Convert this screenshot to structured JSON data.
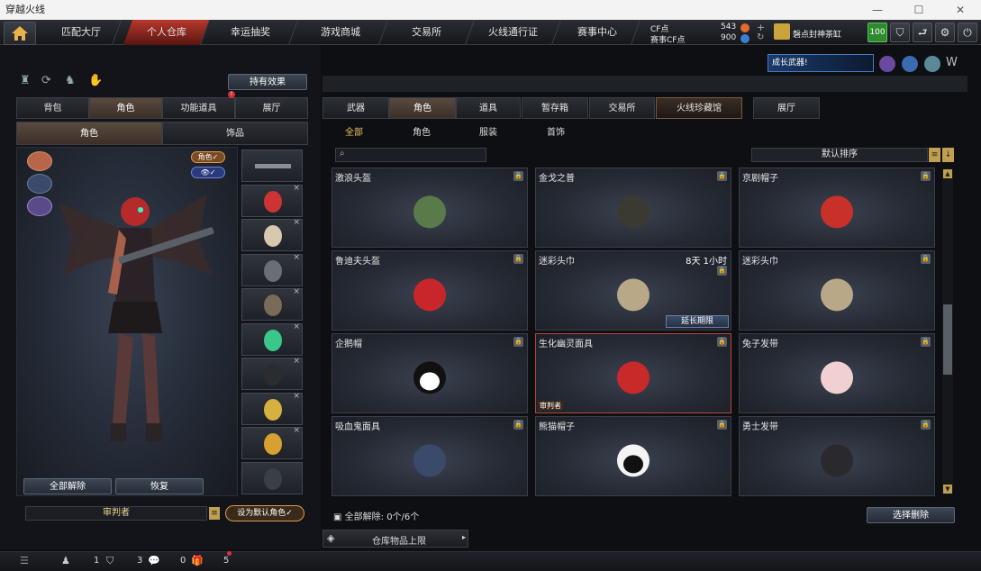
{
  "window": {
    "title": "穿越火线"
  },
  "nav": {
    "tabs": [
      "匹配大厅",
      "个人仓库",
      "幸运抽奖",
      "游戏商城",
      "交易所",
      "火线通行证",
      "赛事中心"
    ],
    "active_index": 1,
    "cf_label": "CF点",
    "cf_value": "543",
    "match_cf_label": "赛事CF点",
    "match_cf_value": "900",
    "username": "磐点封神茶缸",
    "level_badge": "100"
  },
  "left": {
    "effects_button": "持有效果",
    "tabs": [
      "背包",
      "角色",
      "功能道具",
      "展厅"
    ],
    "active_tab": 1,
    "subtabs": [
      "角色",
      "饰品"
    ],
    "role_badge": "角色✓",
    "unequip_all": "全部解除",
    "restore": "恢复",
    "character_name": "审判者",
    "set_default": "设为默认角色✓"
  },
  "right": {
    "tabs": [
      "武器",
      "角色",
      "道具",
      "暂存箱",
      "交易所",
      "火线珍藏馆",
      "展厅"
    ],
    "active_tab": 1,
    "subtabs": [
      "全部",
      "角色",
      "服装",
      "首饰"
    ],
    "sort_label": "默认排序",
    "search_placeholder": "",
    "items": [
      {
        "name": "激浪头盔",
        "icon": "green-helmet-icon"
      },
      {
        "name": "金戈之普",
        "icon": "officer-cap-icon"
      },
      {
        "name": "京剧帽子",
        "icon": "opera-hat-icon"
      },
      {
        "name": "鲁迪夫头盔",
        "icon": "reindeer-helmet-icon"
      },
      {
        "name": "迷彩头巾",
        "icon": "camo-helmet-icon",
        "timer": "8天 1小时",
        "action": "延长期限"
      },
      {
        "name": "迷彩头巾",
        "icon": "camo-helmet-icon"
      },
      {
        "name": "企鹅帽",
        "icon": "penguin-hat-icon"
      },
      {
        "name": "生化幽灵面具",
        "icon": "red-skull-mask-icon",
        "tag": "审判者",
        "selected": true
      },
      {
        "name": "兔子发带",
        "icon": "bunny-ears-icon"
      },
      {
        "name": "吸血鬼面具",
        "icon": "vampire-mask-icon"
      },
      {
        "name": "熊猫帽子",
        "icon": "panda-hat-icon"
      },
      {
        "name": "勇士发带",
        "icon": "warrior-headband-icon"
      }
    ],
    "unequip_count": "全部解除: 0个/6个",
    "select_delete": "选择删除",
    "storage_limit": "仓库物品上限"
  },
  "bottom": {
    "c1": "1",
    "c2": "3",
    "c3": "0",
    "c4": "5"
  }
}
